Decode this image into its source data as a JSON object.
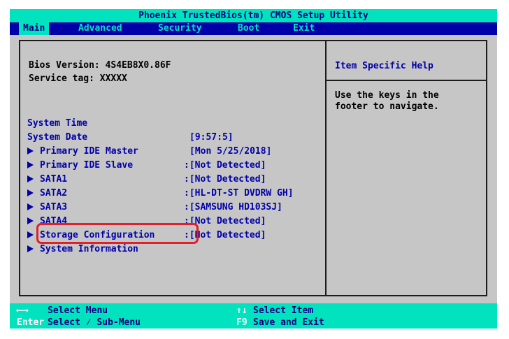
{
  "title": "Phoenix TrustedBios(tm) CMOS Setup Utility",
  "menu": {
    "main": "Main",
    "advanced": "Advanced",
    "security": "Security",
    "boot": "Boot",
    "exit": "Exit"
  },
  "info": {
    "bios_version": "Bios Version: 4S4EB8X0.86F",
    "service_tag": "Service tag: XXXXX"
  },
  "items": [
    {
      "label": "System Time",
      "value": "[9:57:5]"
    },
    {
      "label": "System Date",
      "value": "[Mon 5/25/2018]"
    },
    {
      "label": "Primary IDE Master",
      "value": ":[Not Detected]"
    },
    {
      "label": "Primary IDE Slave",
      "value": ":[Not Detected]"
    },
    {
      "label": "SATA1",
      "value": ":[HL-DT-ST DVDRW GH]"
    },
    {
      "label": "SATA2",
      "value": ":[SAMSUNG HD103SJ]"
    },
    {
      "label": "SATA3",
      "value": ":[Not Detected]"
    },
    {
      "label": "SATA4",
      "value": ":[Not Detected]"
    },
    {
      "label": "Storage Configuration",
      "value": ""
    },
    {
      "label": "System Information",
      "value": ""
    }
  ],
  "help": {
    "title": "Item Specific Help",
    "text": "Use the keys in the\nfooter to navigate."
  },
  "footer": {
    "key1": "⟵⟶",
    "text1": "Select Menu",
    "key2": "↑↓",
    "text2": "Select Item",
    "key3": "Enter",
    "text3": "Select ⁄ Sub-Menu",
    "key4": "F9",
    "text4": "Save and Exit"
  },
  "colors": {
    "cyan": "#00e3be",
    "navy": "#0000a8",
    "gray": "#c6c6c6",
    "highlight": "#e0202a"
  }
}
